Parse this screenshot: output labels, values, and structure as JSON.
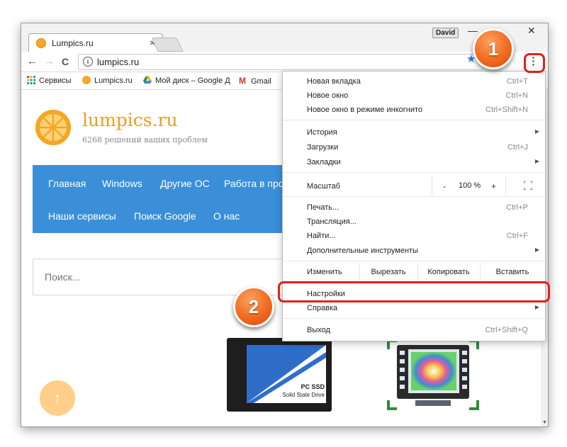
{
  "window": {
    "tab_title": "Lumpics.ru",
    "tab_close": "×",
    "user": "David",
    "minimize": "—",
    "close": "✕"
  },
  "toolbar": {
    "back": "←",
    "forward": "→",
    "reload": "C",
    "url": "lumpics.ru",
    "info_glyph": "i",
    "bookmark_star": "★",
    "menu_glyph": "⋮"
  },
  "bookmarks": [
    {
      "label": "Сервисы",
      "icon": "apps-grid-icon"
    },
    {
      "label": "Lumpics.ru",
      "icon": "lumpics-favicon"
    },
    {
      "label": "Мой диск – Google Д",
      "icon": "google-drive-icon"
    },
    {
      "label": "Gmail",
      "icon": "gmail-icon"
    }
  ],
  "site": {
    "name": "lumpics.ru",
    "tagline": "6268 решений ваших проблем",
    "nav_row1": [
      "Главная",
      "Windows",
      "Другие ОС",
      "Работа в про"
    ],
    "nav_row2": [
      "Наши сервисы",
      "Поиск Google",
      "О нас"
    ],
    "search_placeholder": "Поиск...",
    "up_arrow": "↑",
    "ssd_title": "PC SSD",
    "ssd_subtitle": "Solid State Drive"
  },
  "menu": {
    "new_tab": {
      "label": "Новая вкладка",
      "shortcut": "Ctrl+T"
    },
    "new_window": {
      "label": "Новое окно",
      "shortcut": "Ctrl+N"
    },
    "incognito": {
      "label": "Новое окно в режиме инкогнито",
      "shortcut": "Ctrl+Shift+N"
    },
    "history": {
      "label": "История"
    },
    "downloads": {
      "label": "Загрузки",
      "shortcut": "Ctrl+J"
    },
    "bookmarks": {
      "label": "Закладки"
    },
    "zoom": {
      "label": "Масштаб",
      "minus": "-",
      "value": "100 %",
      "plus": "+"
    },
    "print": {
      "label": "Печать...",
      "shortcut": "Ctrl+P"
    },
    "cast": {
      "label": "Трансляция..."
    },
    "find": {
      "label": "Найти...",
      "shortcut": "Ctrl+F"
    },
    "more_tools": {
      "label": "Дополнительные инструменты"
    },
    "edit": {
      "label": "Изменить",
      "cut": "Вырезать",
      "copy": "Копировать",
      "paste": "Вставить"
    },
    "settings": {
      "label": "Настройки"
    },
    "help": {
      "label": "Справка"
    },
    "exit": {
      "label": "Выход",
      "shortcut": "Ctrl+Shift+Q"
    }
  },
  "callouts": {
    "step1": "1",
    "step2": "2",
    "highlight_color": "#e0201d",
    "badge_color": "#f26a1f"
  }
}
